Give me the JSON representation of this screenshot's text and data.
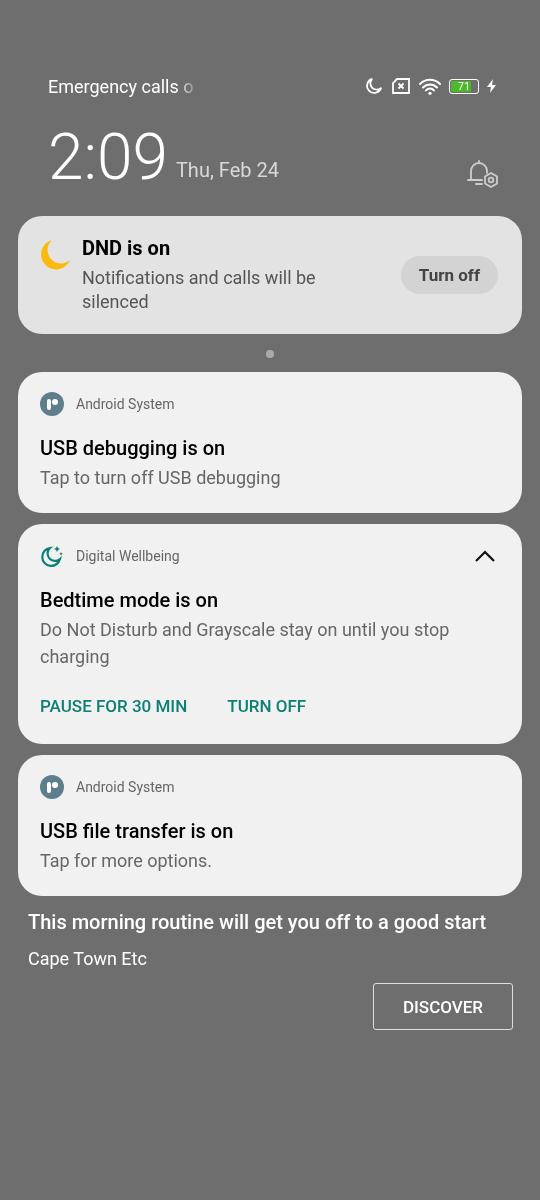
{
  "status_bar": {
    "carrier": "Emergency calls o",
    "battery": "71",
    "charging": true,
    "dnd": true
  },
  "clock": {
    "time": "2:09",
    "date": "Thu, Feb 24"
  },
  "dnd_card": {
    "title": "DND is on",
    "text": "Notifications and calls will be silenced",
    "button": "Turn off"
  },
  "notifications": [
    {
      "kind": "system",
      "app": "Android System",
      "title": "USB debugging is on",
      "text": "Tap to turn off USB debugging"
    },
    {
      "kind": "wellbeing",
      "app": "Digital Wellbeing",
      "title": "Bedtime mode is on",
      "text": "Do Not Disturb and Grayscale stay on until you stop charging",
      "expanded": true,
      "actions": [
        "PAUSE FOR 30 MIN",
        "TURN OFF"
      ]
    },
    {
      "kind": "system",
      "app": "Android System",
      "title": "USB file transfer is on",
      "text": "Tap for more options."
    }
  ],
  "background_widget": {
    "headline": "This morning routine will get you off to a good start",
    "subtitle": "Cape Town Etc",
    "button": "DISCOVER"
  }
}
